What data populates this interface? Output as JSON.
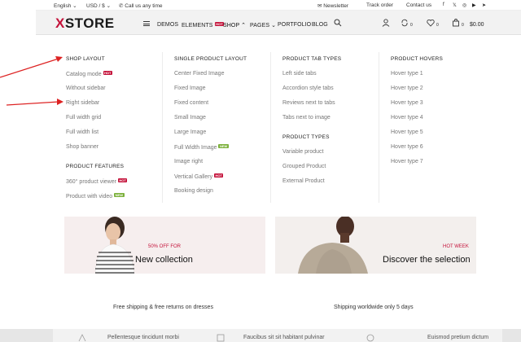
{
  "topbar": {
    "language": "English",
    "currency": "USD / $",
    "phone_text": "Call us any time",
    "newsletter": "Newsletter",
    "track_order": "Track order",
    "contact_us": "Contact us"
  },
  "header": {
    "logo_x": "X",
    "logo_rest": "STORE",
    "nav": {
      "demos": "DEMOS",
      "elements": "ELEMENTS",
      "elements_badge": "HOT",
      "shop": "SHOP",
      "pages": "PAGES",
      "portfolio": "PORTFOLIO",
      "blog": "BLOG"
    },
    "compare_count": "0",
    "wishlist_count": "0",
    "cart_count": "0",
    "cart_amount": "$0.00"
  },
  "mega": {
    "col1": {
      "title": "SHOP LAYOUT",
      "items": [
        "Catalog mode",
        "Without sidebar",
        "Right sidebar",
        "Full width grid",
        "Full width list",
        "Shop banner"
      ],
      "badge_catalog": "HOT",
      "title2": "PRODUCT FEATURES",
      "items2": [
        "360° product viewer",
        "Product with video"
      ],
      "badge_360": "HOT",
      "badge_video": "NEW"
    },
    "col2": {
      "title": "SINGLE PRODUCT LAYOUT",
      "items": [
        "Center Fixed Image",
        "Fixed Image",
        "Fixed content",
        "Small Image",
        "Large Image",
        "Full Width Image",
        "Image right",
        "Vertical Gallery",
        "Booking design"
      ],
      "badge_fullwidth": "NEW",
      "badge_vertical": "HOT"
    },
    "col3": {
      "title": "PRODUCT TAB TYPES",
      "items": [
        "Left side tabs",
        "Accordion style tabs",
        "Reviews next to tabs",
        "Tabs next to image"
      ],
      "title2": "PRODUCT TYPES",
      "items2": [
        "Variable product",
        "Grouped Product",
        "External Product"
      ]
    },
    "col4": {
      "title": "PRODUCT HOVERS",
      "items": [
        "Hover type 1",
        "Hover type 2",
        "Hover type 3",
        "Hover type 4",
        "Hover type 5",
        "Hover type 6",
        "Hover type 7"
      ]
    }
  },
  "banners": {
    "left_small": "50% OFF FOR",
    "left_big": "New collection",
    "right_small": "HOT WEEK",
    "right_big": "Discover the selection",
    "left_foot": "Free shipping & free returns on dresses",
    "right_foot": "Shipping worldwide only 5 days"
  },
  "bottom": {
    "a": "Pellentesque tincidunt morbi",
    "b": "Faucibus sit sit habitant pulvinar",
    "c": "Euismod pretium dictum"
  },
  "colors": {
    "accent": "#c4123a",
    "new_badge": "#7bb03a",
    "header_bg": "#f2f2f2"
  }
}
